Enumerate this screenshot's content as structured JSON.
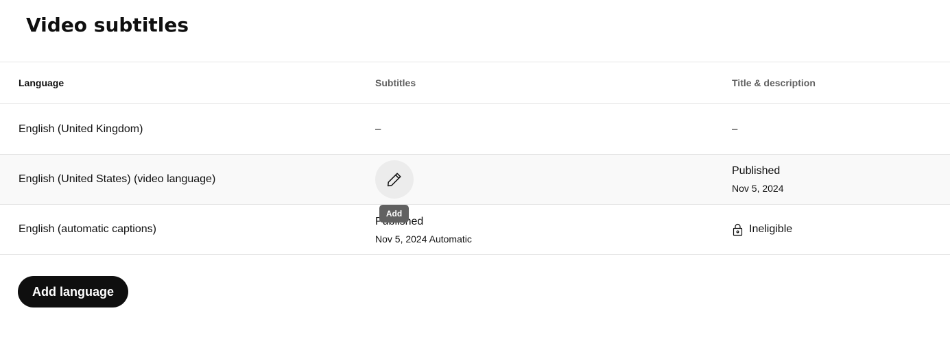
{
  "page": {
    "title": "Video subtitles"
  },
  "table": {
    "headers": {
      "language": "Language",
      "subtitles": "Subtitles",
      "title_description": "Title & description"
    },
    "rows": [
      {
        "language": "English (United Kingdom)",
        "subtitles": "–",
        "title_description": "–"
      },
      {
        "language": "English (United States) (video language)",
        "subtitles_action_icon": "pencil-icon",
        "subtitles_tooltip": "Add",
        "title_description_status": "Published",
        "title_description_date": "Nov 5, 2024"
      },
      {
        "language": "English (automatic captions)",
        "subtitles_status": "Published",
        "subtitles_detail": "Nov 5, 2024 Automatic",
        "title_description_icon": "lock-icon",
        "title_description_status": "Ineligible"
      }
    ]
  },
  "actions": {
    "add_language": "Add language"
  },
  "colors": {
    "primary_button": "#0f0f0f",
    "hover_row": "#f9f9f9",
    "tooltip": "#616161",
    "edit_button": "#ececec"
  }
}
